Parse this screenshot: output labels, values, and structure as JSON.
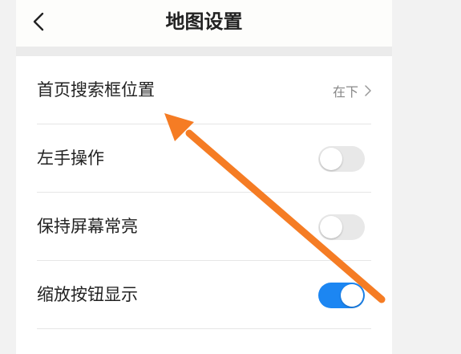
{
  "header": {
    "title": "地图设置",
    "back_icon": "chevron-left-icon"
  },
  "settings": {
    "search_position": {
      "label": "首页搜索框位置",
      "value": "在下"
    },
    "left_hand": {
      "label": "左手操作",
      "enabled": false
    },
    "screen_on": {
      "label": "保持屏幕常亮",
      "enabled": false
    },
    "zoom_buttons": {
      "label": "缩放按钮显示",
      "enabled": true
    }
  },
  "colors": {
    "accent": "#1c86f2",
    "annotation_arrow": "#f57c24"
  }
}
